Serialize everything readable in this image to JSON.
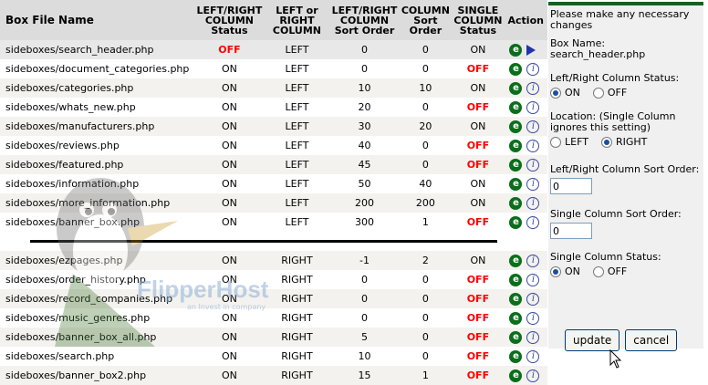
{
  "table": {
    "headers": {
      "file": "Box File Name",
      "status": "LEFT/RIGHT COLUMN Status",
      "column": "LEFT or RIGHT COLUMN",
      "sort": "LEFT/RIGHT COLUMN Sort Order",
      "col_sort": "COLUMN Sort Order",
      "single_status": "SINGLE COLUMN Status",
      "action": "Action"
    },
    "left_rows": [
      {
        "file": "sideboxes/search_header.php",
        "status": "OFF",
        "column": "LEFT",
        "sort": "0",
        "col_sort": "0",
        "single": "ON"
      },
      {
        "file": "sideboxes/document_categories.php",
        "status": "ON",
        "column": "LEFT",
        "sort": "0",
        "col_sort": "0",
        "single": "OFF"
      },
      {
        "file": "sideboxes/categories.php",
        "status": "ON",
        "column": "LEFT",
        "sort": "10",
        "col_sort": "10",
        "single": "ON"
      },
      {
        "file": "sideboxes/whats_new.php",
        "status": "ON",
        "column": "LEFT",
        "sort": "20",
        "col_sort": "0",
        "single": "OFF"
      },
      {
        "file": "sideboxes/manufacturers.php",
        "status": "ON",
        "column": "LEFT",
        "sort": "30",
        "col_sort": "20",
        "single": "ON"
      },
      {
        "file": "sideboxes/reviews.php",
        "status": "ON",
        "column": "LEFT",
        "sort": "40",
        "col_sort": "0",
        "single": "OFF"
      },
      {
        "file": "sideboxes/featured.php",
        "status": "ON",
        "column": "LEFT",
        "sort": "45",
        "col_sort": "0",
        "single": "OFF"
      },
      {
        "file": "sideboxes/information.php",
        "status": "ON",
        "column": "LEFT",
        "sort": "50",
        "col_sort": "40",
        "single": "ON"
      },
      {
        "file": "sideboxes/more_information.php",
        "status": "ON",
        "column": "LEFT",
        "sort": "200",
        "col_sort": "200",
        "single": "ON"
      },
      {
        "file": "sideboxes/banner_box.php",
        "status": "ON",
        "column": "LEFT",
        "sort": "300",
        "col_sort": "1",
        "single": "OFF"
      }
    ],
    "right_rows": [
      {
        "file": "sideboxes/ezpages.php",
        "status": "ON",
        "column": "RIGHT",
        "sort": "-1",
        "col_sort": "2",
        "single": "ON"
      },
      {
        "file": "sideboxes/order_history.php",
        "status": "ON",
        "column": "RIGHT",
        "sort": "0",
        "col_sort": "0",
        "single": "OFF"
      },
      {
        "file": "sideboxes/record_companies.php",
        "status": "ON",
        "column": "RIGHT",
        "sort": "0",
        "col_sort": "0",
        "single": "OFF"
      },
      {
        "file": "sideboxes/music_genres.php",
        "status": "ON",
        "column": "RIGHT",
        "sort": "0",
        "col_sort": "0",
        "single": "OFF"
      },
      {
        "file": "sideboxes/banner_box_all.php",
        "status": "ON",
        "column": "RIGHT",
        "sort": "5",
        "col_sort": "0",
        "single": "OFF"
      },
      {
        "file": "sideboxes/search.php",
        "status": "ON",
        "column": "RIGHT",
        "sort": "10",
        "col_sort": "0",
        "single": "OFF"
      },
      {
        "file": "sideboxes/banner_box2.php",
        "status": "ON",
        "column": "RIGHT",
        "sort": "15",
        "col_sort": "1",
        "single": "OFF"
      }
    ],
    "selected_index": 0,
    "icons": {
      "edit": "edit-icon",
      "info": "info-icon",
      "selected": "arrow-right-icon"
    },
    "edit_glyph": "e",
    "info_glyph": "i"
  },
  "watermark": {
    "text": "FlipperHost",
    "sub": "an Invest in company"
  },
  "panel": {
    "intro": "Please make any necessary changes",
    "box_name_label": "Box Name:",
    "box_name_value": "search_header.php",
    "lr_status_label": "Left/Right Column Status:",
    "lr_status_on": "ON",
    "lr_status_off": "OFF",
    "lr_status_selected": "ON",
    "location_label": "Location: (Single Column ignores this setting)",
    "location_left": "LEFT",
    "location_right": "RIGHT",
    "location_selected": "RIGHT",
    "lr_sort_label": "Left/Right Column Sort Order:",
    "lr_sort_value": "0",
    "single_sort_label": "Single Column Sort Order:",
    "single_sort_value": "0",
    "single_status_label": "Single Column Status:",
    "single_status_on": "ON",
    "single_status_off": "OFF",
    "single_status_selected": "ON",
    "update_label": "update",
    "cancel_label": "cancel"
  },
  "colors": {
    "off": "#ff0000",
    "accent": "#1b5e20",
    "edit_icon": "#0a6e1a"
  }
}
